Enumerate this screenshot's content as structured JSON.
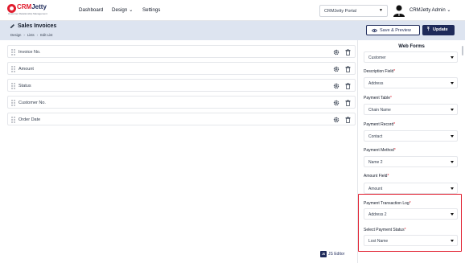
{
  "brand": {
    "logo_text_crm": "CRM",
    "logo_text_jetty": "Jetty",
    "tagline": "Customer Relationship Management"
  },
  "nav": {
    "items": [
      "Dashboard",
      "Design",
      "Settings"
    ],
    "design_chevron": "⌄"
  },
  "portal": {
    "selected": "CRMJetty Portal"
  },
  "user": {
    "name": "CRMJetty Admin"
  },
  "header": {
    "title": "Sales Invoices",
    "breadcrumb": [
      "Design",
      "Lists",
      "Edit List"
    ],
    "save_preview_label": "Save & Preview",
    "update_label": "Update"
  },
  "fields": [
    "Invoice No.",
    "Amount",
    "Status",
    "Customer No.",
    "Order Date"
  ],
  "js_editor": {
    "icon": "JS",
    "label": "JS Editor"
  },
  "right_panel": {
    "title": "Web Forms",
    "top_value": "Customer",
    "groups": [
      {
        "label": "Description Field",
        "value": "Address"
      },
      {
        "label": "Payment Table",
        "value": "Chain Name"
      },
      {
        "label": "Payment Record",
        "value": "Contact"
      },
      {
        "label": "Payment Method",
        "value": "Name 2"
      },
      {
        "label": "Amount Field",
        "value": "Amount"
      },
      {
        "label": "Payment Transaction Log",
        "value": "Address 2"
      },
      {
        "label": "Select Payment Status",
        "value": "Lost Name"
      }
    ],
    "required_marker": "*"
  },
  "colors": {
    "brand_navy": "#1e2a5a",
    "brand_red": "#e11d2e",
    "header_bg": "#dde4f0",
    "highlight": "#e11d2e"
  }
}
